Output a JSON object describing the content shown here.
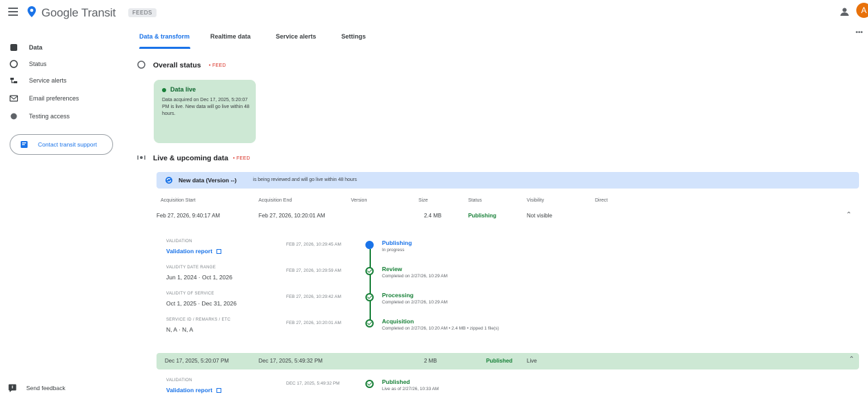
{
  "app": {
    "brand": "Google Transit",
    "env_chip": "FEEDS",
    "avatar_letter": "A"
  },
  "sidebar": {
    "items": [
      {
        "label": "Data",
        "icon": "database-icon"
      },
      {
        "label": "Status",
        "icon": "status-icon"
      },
      {
        "label": "Service alerts",
        "icon": "alerts-icon"
      },
      {
        "label": "Email preferences",
        "icon": "email-icon"
      },
      {
        "label": "Testing access",
        "icon": "testing-icon"
      }
    ],
    "contact_button": "Contact transit support",
    "feedback": "Send feedback"
  },
  "tabs": [
    {
      "label": "Data & transform"
    },
    {
      "label": "Realtime data"
    },
    {
      "label": "Service alerts"
    },
    {
      "label": "Settings"
    }
  ],
  "overall_status": {
    "title": "Overall status",
    "chip": "• FEED",
    "card_title": "Data live",
    "card_text": "Data acquired on Dec 17, 2025, 5:20:07 PM is live. New data will go live within 48 hours."
  },
  "live_upcoming": {
    "title": "Live & upcoming data",
    "chip": "• FEED",
    "banner_title": "New data (Version --)",
    "banner_text": "is being reviewed and will go live within 48 hours",
    "columns": [
      "Acquisition Start",
      "Acquisition End",
      "Version",
      "Size",
      "Status",
      "Visibility",
      "Direct"
    ],
    "row1": [
      "Feb 27, 2026, 9:40:17 AM",
      "Feb 27, 2026, 10:20:01 AM",
      "",
      "2.4 MB",
      "Publishing",
      "Not visible",
      ""
    ],
    "timeline": [
      {
        "label": "VALIDATION",
        "value": "Validation report",
        "link": true,
        "time": "FEB 27, 2026, 10:29:45 AM",
        "step": "Publishing",
        "sub": "In progress",
        "current": true
      },
      {
        "label": "VALIDITY DATE RANGE",
        "value": "Jun 1, 2024 · Oct 1, 2026",
        "link": false,
        "time": "FEB 27, 2026, 10:29:59 AM",
        "step": "Review",
        "sub": "Completed on 2/27/26, 10:29 AM",
        "current": false
      },
      {
        "label": "VALIDITY OF SERVICE",
        "value": "Oct 1, 2025 · Dec 31, 2026",
        "link": false,
        "time": "FEB 27, 2026, 10:29:42 AM",
        "step": "Processing",
        "sub": "Completed on 2/27/26, 10:29 AM",
        "current": false
      },
      {
        "label": "SERVICE ID / REMARKS / ETC",
        "value": "N, A · N, A",
        "link": false,
        "time": "FEB 27, 2026, 10:20:01 AM",
        "step": "Acquisition",
        "sub": "Completed on 2/27/26, 10:20 AM • 2.4 MB • zipped 1 file(s)",
        "current": false
      }
    ],
    "row2": [
      "Dec 17, 2025, 5:20:07 PM",
      "Dec 17, 2025, 5:49:32 PM",
      "",
      "2 MB",
      "Published",
      "Live",
      ""
    ],
    "timeline2": {
      "label": "VALIDATION",
      "value": "Validation report",
      "time": "DEC 17, 2025, 5:49:32 PM",
      "step": "Published",
      "sub": "Live as of 2/27/26, 10:33 AM"
    }
  },
  "colors": {
    "accent": "#1a73e8",
    "success": "#188038",
    "success_bg": "#cde8d4",
    "banner_bg": "#d2e3fc"
  }
}
